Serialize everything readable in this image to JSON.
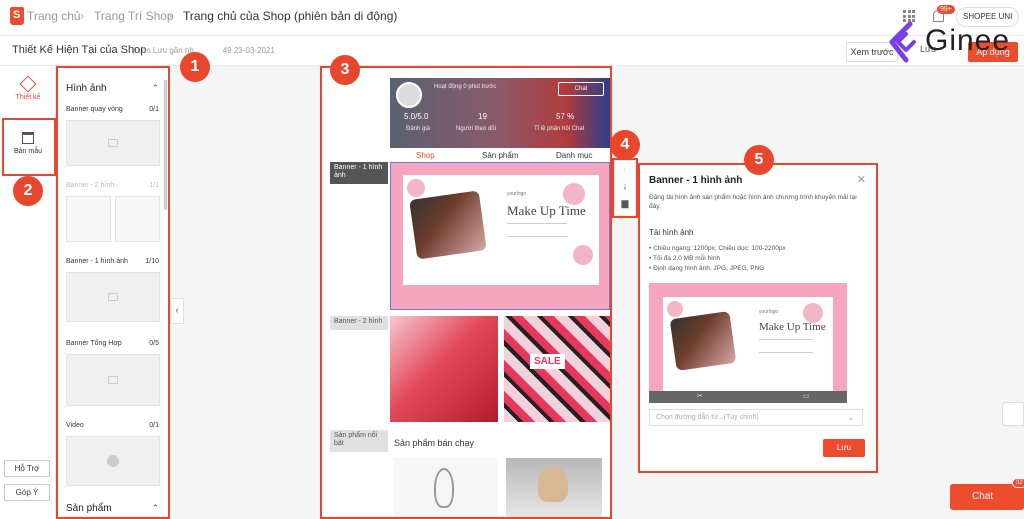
{
  "breadcrumb": {
    "home": "Trang chủ",
    "decor": "Trang Trí Shop",
    "current": "Trang chủ của Shop (phiên bản di động)"
  },
  "header": {
    "notification_badge": "99+",
    "account": "SHOPEE UNI"
  },
  "watermark": {
    "brand": "Ginee",
    "brand_color": "#7b3fe4"
  },
  "subbar": {
    "title": "Thiết Kế Hiện Tại của Shop",
    "saved_prefix": "| Lần Lưu gần nh",
    "saved_suffix": "49 23-03-2021",
    "preview_label": "Xem trước",
    "save_label": "Lưu",
    "publish_label": "Áp dụng"
  },
  "rail": {
    "design_label": "Thiết kế",
    "template_label": "Bản mẫu",
    "help_label": "Hỗ Trợ",
    "feedback_label": "Góp Ý"
  },
  "panel": {
    "section_images": "Hình ảnh",
    "section_products": "Sản phẩm",
    "items": [
      {
        "label": "Banner quay vòng",
        "count": "0/1"
      },
      {
        "label": "Banner - 2 hình",
        "count": "1/1"
      },
      {
        "label": "Banner - 1 hình ảnh",
        "count": "1/10"
      },
      {
        "label": "Banner Tổng Hợp",
        "count": "0/5"
      },
      {
        "label": "Video",
        "count": "0/1"
      }
    ]
  },
  "callouts": [
    "1",
    "2",
    "3",
    "4",
    "5"
  ],
  "shop": {
    "online_status": "Hoạt động 0 phút trước",
    "chat_label": "Chat",
    "stats": [
      {
        "value": "5.0/5.0",
        "label": "Đánh giá"
      },
      {
        "value": "19",
        "label": "Người theo dõi"
      },
      {
        "value": "57 %",
        "label": "Tỉ lệ phản hồi Chat"
      }
    ],
    "tabs": [
      "Shop",
      "Sản phẩm",
      "Danh mục"
    ],
    "section_banner1": "Banner - 1 hình ảnh",
    "section_banner2": "Banner - 2 hình",
    "section_featured": "Sản phẩm nổi bật",
    "best_selling": "Sản phẩm bán chạy",
    "banner_heading": "Make Up Time",
    "banner_logo": "yourlogo",
    "sale_text": "SALE"
  },
  "settings": {
    "title": "Banner - 1 hình ảnh",
    "description": "Đăng tải hình ảnh sản phẩm hoặc hình ảnh chương trình khuyến mãi tại đây.",
    "upload_title": "Tải hình ảnh",
    "rules": [
      "• Chiều ngang: 1200px; Chiều dọc: 100-2200px",
      "• Tối đa 2.0 MB mỗi hình",
      "• Định dạng hình ảnh: JPG, JPEG, PNG"
    ],
    "link_placeholder": "Chọn đường dẫn từ...(Tùy chỉnh)",
    "save_label": "Lưu"
  },
  "floating": {
    "chat_label": "Chat",
    "chat_badge": "32"
  },
  "colors": {
    "accent": "#ee4d2d",
    "callout": "#e8472d"
  }
}
